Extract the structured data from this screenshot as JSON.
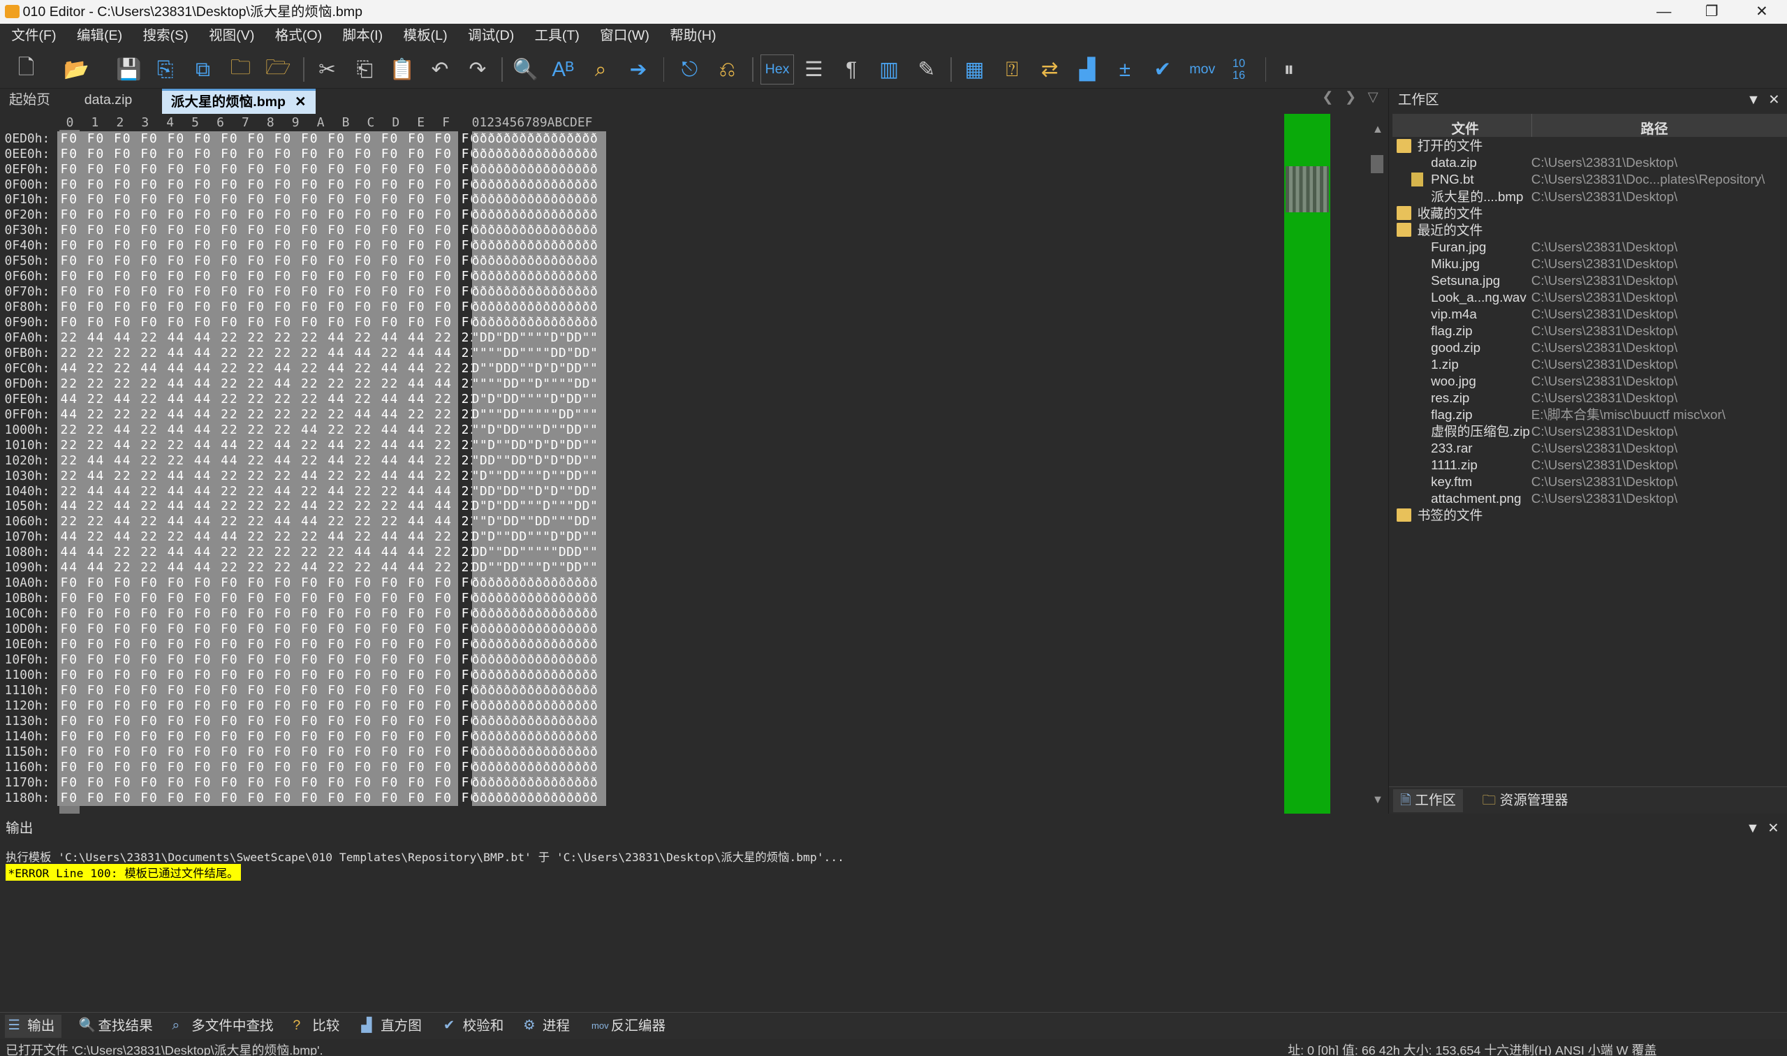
{
  "window": {
    "title": "010 Editor - C:\\Users\\23831\\Desktop\\派大星的烦恼.bmp",
    "minimize": "—",
    "maximize": "❐",
    "close": "✕"
  },
  "menu": [
    "文件(F)",
    "编辑(E)",
    "搜索(S)",
    "视图(V)",
    "格式(O)",
    "脚本(I)",
    "模板(L)",
    "调试(D)",
    "工具(T)",
    "窗口(W)",
    "帮助(H)"
  ],
  "toolbar": {
    "hex_label": "Hex",
    "mov_label": "mov",
    "base_label": "10\n16"
  },
  "tabs": [
    {
      "label": "起始页"
    },
    {
      "label": "data.zip"
    },
    {
      "label": "派大星的烦恼.bmp",
      "close": "✕"
    }
  ],
  "hex": {
    "col_header": [
      "0",
      "1",
      "2",
      "3",
      "4",
      "5",
      "6",
      "7",
      "8",
      "9",
      "A",
      "B",
      "C",
      "D",
      "E",
      "F"
    ],
    "ascii_header": "0123456789ABCDEF",
    "rows": [
      {
        "addr": "0ED0h:",
        "bytes": "F0 F0 F0 F0 F0 F0 F0 F0 F0 F0 F0 F0 F0 F0 F0 F0",
        "ascii": "ðððððððððððððððð"
      },
      {
        "addr": "0EE0h:",
        "bytes": "F0 F0 F0 F0 F0 F0 F0 F0 F0 F0 F0 F0 F0 F0 F0 F0",
        "ascii": "ðððððððððððððððð"
      },
      {
        "addr": "0EF0h:",
        "bytes": "F0 F0 F0 F0 F0 F0 F0 F0 F0 F0 F0 F0 F0 F0 F0 F0",
        "ascii": "ðððððððððððððððð"
      },
      {
        "addr": "0F00h:",
        "bytes": "F0 F0 F0 F0 F0 F0 F0 F0 F0 F0 F0 F0 F0 F0 F0 F0",
        "ascii": "ðððððððððððððððð"
      },
      {
        "addr": "0F10h:",
        "bytes": "F0 F0 F0 F0 F0 F0 F0 F0 F0 F0 F0 F0 F0 F0 F0 F0",
        "ascii": "ðððððððððððððððð"
      },
      {
        "addr": "0F20h:",
        "bytes": "F0 F0 F0 F0 F0 F0 F0 F0 F0 F0 F0 F0 F0 F0 F0 F0",
        "ascii": "ðððððððððððððððð"
      },
      {
        "addr": "0F30h:",
        "bytes": "F0 F0 F0 F0 F0 F0 F0 F0 F0 F0 F0 F0 F0 F0 F0 F0",
        "ascii": "ðððððððððððððððð"
      },
      {
        "addr": "0F40h:",
        "bytes": "F0 F0 F0 F0 F0 F0 F0 F0 F0 F0 F0 F0 F0 F0 F0 F0",
        "ascii": "ðððððððððððððððð"
      },
      {
        "addr": "0F50h:",
        "bytes": "F0 F0 F0 F0 F0 F0 F0 F0 F0 F0 F0 F0 F0 F0 F0 F0",
        "ascii": "ðððððððððððððððð"
      },
      {
        "addr": "0F60h:",
        "bytes": "F0 F0 F0 F0 F0 F0 F0 F0 F0 F0 F0 F0 F0 F0 F0 F0",
        "ascii": "ðððððððððððððððð"
      },
      {
        "addr": "0F70h:",
        "bytes": "F0 F0 F0 F0 F0 F0 F0 F0 F0 F0 F0 F0 F0 F0 F0 F0",
        "ascii": "ðððððððððððððððð"
      },
      {
        "addr": "0F80h:",
        "bytes": "F0 F0 F0 F0 F0 F0 F0 F0 F0 F0 F0 F0 F0 F0 F0 F0",
        "ascii": "ðððððððððððððððð"
      },
      {
        "addr": "0F90h:",
        "bytes": "F0 F0 F0 F0 F0 F0 F0 F0 F0 F0 F0 F0 F0 F0 F0 F0",
        "ascii": "ðððððððððððððððð"
      },
      {
        "addr": "0FA0h:",
        "bytes": "22 44 44 22 44 44 22 22 22 22 44 22 44 44 22 22",
        "ascii": "\"DD\"DD\"\"\"\"D\"DD\"\""
      },
      {
        "addr": "0FB0h:",
        "bytes": "22 22 22 22 44 44 22 22 22 22 44 44 22 44 44 22",
        "ascii": "\"\"\"\"DD\"\"\"\"DD\"DD\""
      },
      {
        "addr": "0FC0h:",
        "bytes": "44 22 22 44 44 44 22 22 44 22 44 22 44 44 22 22",
        "ascii": "D\"\"DDD\"\"D\"D\"DD\"\""
      },
      {
        "addr": "0FD0h:",
        "bytes": "22 22 22 22 44 44 22 22 44 22 22 22 22 44 44 22",
        "ascii": "\"\"\"\"DD\"\"D\"\"\"\"DD\""
      },
      {
        "addr": "0FE0h:",
        "bytes": "44 22 44 22 44 44 22 22 22 22 44 22 44 44 22 22",
        "ascii": "D\"D\"DD\"\"\"\"D\"DD\"\""
      },
      {
        "addr": "0FF0h:",
        "bytes": "44 22 22 22 44 44 22 22 22 22 22 44 44 22 22 22",
        "ascii": "D\"\"\"DD\"\"\"\"\"DD\"\"\""
      },
      {
        "addr": "1000h:",
        "bytes": "22 22 44 22 44 44 22 22 22 44 22 22 44 44 22 22",
        "ascii": "\"\"D\"DD\"\"\"D\"\"DD\"\""
      },
      {
        "addr": "1010h:",
        "bytes": "22 22 44 22 22 44 44 22 44 22 44 22 44 44 22 22",
        "ascii": "\"\"D\"\"DD\"D\"D\"DD\"\""
      },
      {
        "addr": "1020h:",
        "bytes": "22 44 44 22 22 44 44 22 44 22 44 22 44 44 22 22",
        "ascii": "\"DD\"\"DD\"D\"D\"DD\"\""
      },
      {
        "addr": "1030h:",
        "bytes": "22 44 22 22 44 44 22 22 22 44 22 22 44 44 22 22",
        "ascii": "\"D\"\"DD\"\"\"D\"\"DD\"\""
      },
      {
        "addr": "1040h:",
        "bytes": "22 44 44 22 44 44 22 22 44 22 44 22 22 44 44 22",
        "ascii": "\"DD\"DD\"\"D\"D\"\"DD\""
      },
      {
        "addr": "1050h:",
        "bytes": "44 22 44 22 44 44 22 22 22 44 22 22 22 44 44 22",
        "ascii": "D\"D\"DD\"\"\"D\"\"\"DD\""
      },
      {
        "addr": "1060h:",
        "bytes": "22 22 44 22 44 44 22 22 44 44 22 22 22 44 44 22",
        "ascii": "\"\"D\"DD\"\"DD\"\"\"DD\""
      },
      {
        "addr": "1070h:",
        "bytes": "44 22 44 22 22 44 44 22 22 22 44 22 44 44 22 22",
        "ascii": "D\"D\"\"DD\"\"\"D\"DD\"\""
      },
      {
        "addr": "1080h:",
        "bytes": "44 44 22 22 44 44 22 22 22 22 22 44 44 44 22 22",
        "ascii": "DD\"\"DD\"\"\"\"\"DDD\"\""
      },
      {
        "addr": "1090h:",
        "bytes": "44 44 22 22 44 44 22 22 22 44 22 22 44 44 22 22",
        "ascii": "DD\"\"DD\"\"\"D\"\"DD\"\""
      },
      {
        "addr": "10A0h:",
        "bytes": "F0 F0 F0 F0 F0 F0 F0 F0 F0 F0 F0 F0 F0 F0 F0 F0",
        "ascii": "ðððððððððððððððð"
      },
      {
        "addr": "10B0h:",
        "bytes": "F0 F0 F0 F0 F0 F0 F0 F0 F0 F0 F0 F0 F0 F0 F0 F0",
        "ascii": "ðððððððððððððððð"
      },
      {
        "addr": "10C0h:",
        "bytes": "F0 F0 F0 F0 F0 F0 F0 F0 F0 F0 F0 F0 F0 F0 F0 F0",
        "ascii": "ðððððððððððððððð"
      },
      {
        "addr": "10D0h:",
        "bytes": "F0 F0 F0 F0 F0 F0 F0 F0 F0 F0 F0 F0 F0 F0 F0 F0",
        "ascii": "ðððððððððððððððð"
      },
      {
        "addr": "10E0h:",
        "bytes": "F0 F0 F0 F0 F0 F0 F0 F0 F0 F0 F0 F0 F0 F0 F0 F0",
        "ascii": "ðððððððððððððððð"
      },
      {
        "addr": "10F0h:",
        "bytes": "F0 F0 F0 F0 F0 F0 F0 F0 F0 F0 F0 F0 F0 F0 F0 F0",
        "ascii": "ðððððððððððððððð"
      },
      {
        "addr": "1100h:",
        "bytes": "F0 F0 F0 F0 F0 F0 F0 F0 F0 F0 F0 F0 F0 F0 F0 F0",
        "ascii": "ðððððððððððððððð"
      },
      {
        "addr": "1110h:",
        "bytes": "F0 F0 F0 F0 F0 F0 F0 F0 F0 F0 F0 F0 F0 F0 F0 F0",
        "ascii": "ðððððððððððððððð"
      },
      {
        "addr": "1120h:",
        "bytes": "F0 F0 F0 F0 F0 F0 F0 F0 F0 F0 F0 F0 F0 F0 F0 F0",
        "ascii": "ðððððððððððððððð"
      },
      {
        "addr": "1130h:",
        "bytes": "F0 F0 F0 F0 F0 F0 F0 F0 F0 F0 F0 F0 F0 F0 F0 F0",
        "ascii": "ðððððððððððððððð"
      },
      {
        "addr": "1140h:",
        "bytes": "F0 F0 F0 F0 F0 F0 F0 F0 F0 F0 F0 F0 F0 F0 F0 F0",
        "ascii": "ðððððððððððððððð"
      },
      {
        "addr": "1150h:",
        "bytes": "F0 F0 F0 F0 F0 F0 F0 F0 F0 F0 F0 F0 F0 F0 F0 F0",
        "ascii": "ðððððððððððððððð"
      },
      {
        "addr": "1160h:",
        "bytes": "F0 F0 F0 F0 F0 F0 F0 F0 F0 F0 F0 F0 F0 F0 F0 F0",
        "ascii": "ðððððððððððððððð"
      },
      {
        "addr": "1170h:",
        "bytes": "F0 F0 F0 F0 F0 F0 F0 F0 F0 F0 F0 F0 F0 F0 F0 F0",
        "ascii": "ðððððððððððððððð"
      },
      {
        "addr": "1180h:",
        "bytes": "F0 F0 F0 F0 F0 F0 F0 F0 F0 F0 F0 F0 F0 F0 F0 F0",
        "ascii": "ðððððððððððððððð"
      }
    ]
  },
  "workspace": {
    "title": "工作区",
    "col_file": "文件",
    "col_path": "路径",
    "items": [
      {
        "kind": "group",
        "name": "打开的文件",
        "path": ""
      },
      {
        "kind": "file",
        "name": "data.zip",
        "path": "C:\\Users\\23831\\Desktop\\"
      },
      {
        "kind": "file",
        "name": "PNG.bt",
        "path": "C:\\Users\\23831\\Doc...plates\\Repository\\"
      },
      {
        "kind": "file",
        "name": "派大星的....bmp",
        "path": "C:\\Users\\23831\\Desktop\\"
      },
      {
        "kind": "group",
        "name": "收藏的文件",
        "path": ""
      },
      {
        "kind": "group",
        "name": "最近的文件",
        "path": ""
      },
      {
        "kind": "file",
        "name": "Furan.jpg",
        "path": "C:\\Users\\23831\\Desktop\\"
      },
      {
        "kind": "file",
        "name": "Miku.jpg",
        "path": "C:\\Users\\23831\\Desktop\\"
      },
      {
        "kind": "file",
        "name": "Setsuna.jpg",
        "path": "C:\\Users\\23831\\Desktop\\"
      },
      {
        "kind": "file",
        "name": "Look_a...ng.wav",
        "path": "C:\\Users\\23831\\Desktop\\"
      },
      {
        "kind": "file",
        "name": "vip.m4a",
        "path": "C:\\Users\\23831\\Desktop\\"
      },
      {
        "kind": "file",
        "name": "flag.zip",
        "path": "C:\\Users\\23831\\Desktop\\"
      },
      {
        "kind": "file",
        "name": "good.zip",
        "path": "C:\\Users\\23831\\Desktop\\"
      },
      {
        "kind": "file",
        "name": "1.zip",
        "path": "C:\\Users\\23831\\Desktop\\"
      },
      {
        "kind": "file",
        "name": "woo.jpg",
        "path": "C:\\Users\\23831\\Desktop\\"
      },
      {
        "kind": "file",
        "name": "res.zip",
        "path": "C:\\Users\\23831\\Desktop\\"
      },
      {
        "kind": "file",
        "name": "flag.zip",
        "path": "E:\\脚本合集\\misc\\buuctf misc\\xor\\"
      },
      {
        "kind": "file",
        "name": "虚假的压缩包.zip",
        "path": "C:\\Users\\23831\\Desktop\\"
      },
      {
        "kind": "file",
        "name": "233.rar",
        "path": "C:\\Users\\23831\\Desktop\\"
      },
      {
        "kind": "file",
        "name": "1111.zip",
        "path": "C:\\Users\\23831\\Desktop\\"
      },
      {
        "kind": "file",
        "name": "key.ftm",
        "path": "C:\\Users\\23831\\Desktop\\"
      },
      {
        "kind": "file",
        "name": "attachment.png",
        "path": "C:\\Users\\23831\\Desktop\\"
      },
      {
        "kind": "group",
        "name": "书签的文件",
        "path": ""
      }
    ],
    "footer_tabs": [
      "工作区",
      "资源管理器"
    ]
  },
  "output": {
    "title": "输出",
    "line1": "执行模板 'C:\\Users\\23831\\Documents\\SweetScape\\010 Templates\\Repository\\BMP.bt' 于 'C:\\Users\\23831\\Desktop\\派大星的烦恼.bmp'...",
    "line2": "*ERROR Line 100: 模板已通过文件结尾。"
  },
  "bottom_tabs": [
    "输出",
    "查找结果",
    "多文件中查找",
    "比较",
    "直方图",
    "校验和",
    "进程",
    "反汇编器"
  ],
  "status": {
    "left": "已打开文件 'C:\\Users\\23831\\Desktop\\派大星的烦恼.bmp'.",
    "right": "址: 0 [0h]   值: 66 42h   大小: 153,654      十六进制(H)  ANSI  小端      W   覆盖"
  },
  "colors": {
    "green_bar": "#0aaa0a",
    "selection": "#8c8c8c",
    "error_bg": "#ffff00",
    "active_tab": "#cfe4f7"
  }
}
